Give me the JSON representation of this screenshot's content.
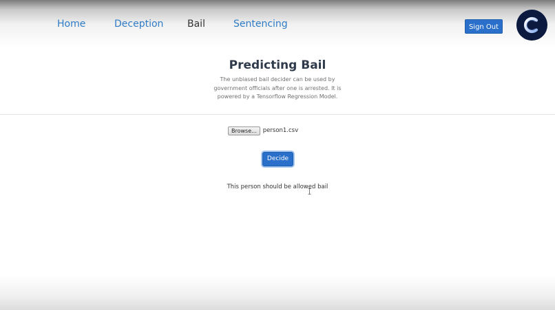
{
  "nav": {
    "items": [
      {
        "label": "Home"
      },
      {
        "label": "Deception"
      },
      {
        "label": "Bail"
      },
      {
        "label": "Sentencing"
      }
    ],
    "active": "Bail"
  },
  "header": {
    "signout_label": "Sign Out",
    "avatar_letter": "C",
    "avatar_bg": "#0d1a3f"
  },
  "main": {
    "title": "Predicting Bail",
    "description": "The unbiased bail decider can be used by government officials after one is arrested. It is powered by a Tensorflow Regression Model.",
    "file": {
      "browse_label": "Browse...",
      "filename": "person1.csv"
    },
    "decide_label": "Decide",
    "result": "This person should be allowed bail"
  },
  "colors": {
    "accent": "#2a6fc9",
    "link": "#2e7bc6",
    "title": "#2f3a4a"
  }
}
